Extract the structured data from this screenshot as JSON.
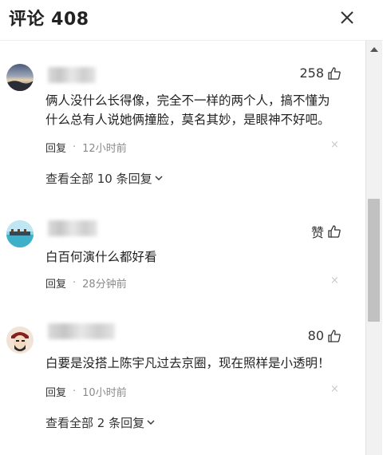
{
  "header": {
    "title": "评论 408"
  },
  "comments": [
    {
      "likes": "258",
      "text": "俩人没什么长得像，完全不一样的两个人，搞不懂为什么总有人说她俩撞脸，莫名其妙，是眼神不好吧。",
      "reply_label": "回复",
      "separator": "·",
      "time": "12小时前",
      "view_replies": "查看全部 10 条回复"
    },
    {
      "likes": "赞",
      "text": "白百何演什么都好看",
      "reply_label": "回复",
      "separator": "·",
      "time": "28分钟前"
    },
    {
      "likes": "80",
      "text": "白要是没搭上陈宇凡过去京圈，现在照样是小透明！",
      "reply_label": "回复",
      "separator": "·",
      "time": "10小时前",
      "view_replies": "查看全部 2 条回复"
    }
  ],
  "icons": {
    "close": "close-icon",
    "like": "thumbs-up-icon",
    "delete": "×",
    "chevron": "chevron-down-icon"
  },
  "colors": {
    "text": "#222222",
    "meta": "#8a8a8a",
    "scrollbar_thumb": "#c1c1c1"
  }
}
